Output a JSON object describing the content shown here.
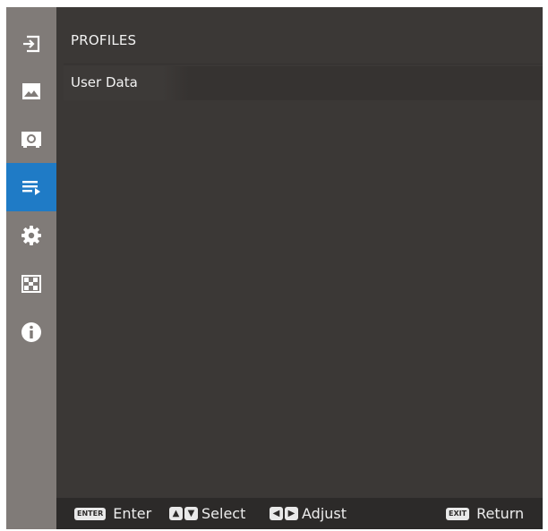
{
  "sidebar": {
    "items": [
      {
        "icon": "input-icon",
        "active": false
      },
      {
        "icon": "picture-icon",
        "active": false
      },
      {
        "icon": "display-icon",
        "active": false
      },
      {
        "icon": "profiles-icon",
        "active": true
      },
      {
        "icon": "settings-icon",
        "active": false
      },
      {
        "icon": "pattern-icon",
        "active": false
      },
      {
        "icon": "info-icon",
        "active": false
      }
    ]
  },
  "menu": {
    "title": "PROFILES",
    "items": [
      {
        "label": "User Data"
      }
    ]
  },
  "footer": {
    "enter_key": "ENTER",
    "enter_label": "Enter",
    "select_label": "Select",
    "adjust_label": "Adjust",
    "exit_key": "EXIT",
    "return_label": "Return"
  },
  "colors": {
    "accent": "#1f7bc6",
    "sidebar": "#807b78",
    "background": "#3b3836",
    "footer": "#2c2a29"
  }
}
